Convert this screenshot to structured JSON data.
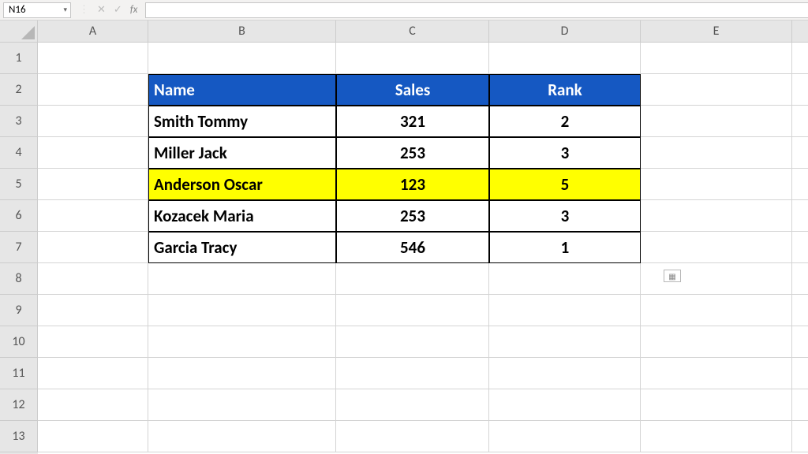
{
  "formula_bar": {
    "name_box": "N16",
    "cancel": "✕",
    "confirm": "✓",
    "fx": "fx",
    "formula": ""
  },
  "columns": [
    "A",
    "B",
    "C",
    "D",
    "E",
    ""
  ],
  "rows": [
    "1",
    "2",
    "3",
    "4",
    "5",
    "6",
    "7",
    "8",
    "9",
    "10",
    "11",
    "12",
    "13"
  ],
  "table": {
    "headers": {
      "name": "Name",
      "sales": "Sales",
      "rank": "Rank"
    },
    "data": [
      {
        "name": "Smith Tommy",
        "sales": "321",
        "rank": "2",
        "highlight": false
      },
      {
        "name": "Miller Jack",
        "sales": "253",
        "rank": "3",
        "highlight": false
      },
      {
        "name": "Anderson Oscar",
        "sales": "123",
        "rank": "5",
        "highlight": true
      },
      {
        "name": "Kozacek Maria",
        "sales": "253",
        "rank": "3",
        "highlight": false
      },
      {
        "name": "Garcia Tracy",
        "sales": "546",
        "rank": "1",
        "highlight": false
      }
    ]
  },
  "smart_tag": "▦"
}
